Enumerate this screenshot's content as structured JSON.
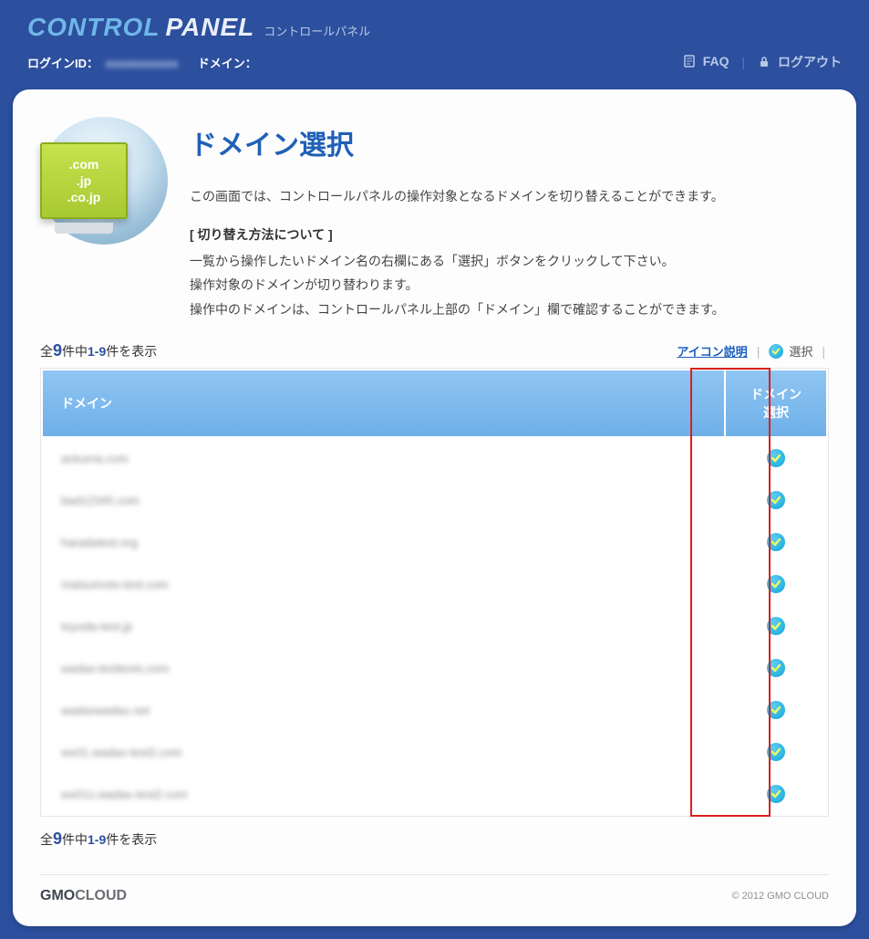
{
  "brand": {
    "control": "CONTROL",
    "panel": "PANEL",
    "jp": "コントロールパネル"
  },
  "topbar": {
    "login_label": "ログインID：",
    "login_value": "xxxxxxxxxxx",
    "domain_label": "ドメイン：",
    "faq": "FAQ",
    "logout": "ログアウト"
  },
  "badge": {
    "l1": ".com",
    "l2": ".jp",
    "l3": ".co.jp"
  },
  "page": {
    "title": "ドメイン選択",
    "intro": "この画面では、コントロールパネルの操作対象となるドメインを切り替えることができます。",
    "subhead": "[ 切り替え方法について ]",
    "desc1": "一覧から操作したいドメイン名の右欄にある「選択」ボタンをクリックして下さい。",
    "desc2": "操作対象のドメインが切り替わります。",
    "desc3": "操作中のドメインは、コントロールパネル上部の「ドメイン」欄で確認することができます。"
  },
  "counter": {
    "prefix": "全",
    "total": "9",
    "mid": "件中",
    "range": "1-9",
    "suffix": "件を表示"
  },
  "toolbar": {
    "icon_help": "アイコン説明",
    "legend": "選択"
  },
  "table": {
    "col_domain": "ドメイン",
    "col_select_l1": "ドメイン",
    "col_select_l2": "選択",
    "rows": [
      {
        "name": "ackuma.com"
      },
      {
        "name": "bad12345.com"
      },
      {
        "name": "haradatest.org"
      },
      {
        "name": "matsumoto-test.com"
      },
      {
        "name": "toyoda-test.jp"
      },
      {
        "name": "wadas-testtexts.com"
      },
      {
        "name": "wadaxwadax.net"
      },
      {
        "name": "wx01.wadax-test2.com"
      },
      {
        "name": "wx01s.wadax-test2.com"
      }
    ]
  },
  "footer": {
    "gmo_bold": "GMO",
    "gmo_light": "CLOUD",
    "copyright": "© 2012 GMO CLOUD"
  }
}
